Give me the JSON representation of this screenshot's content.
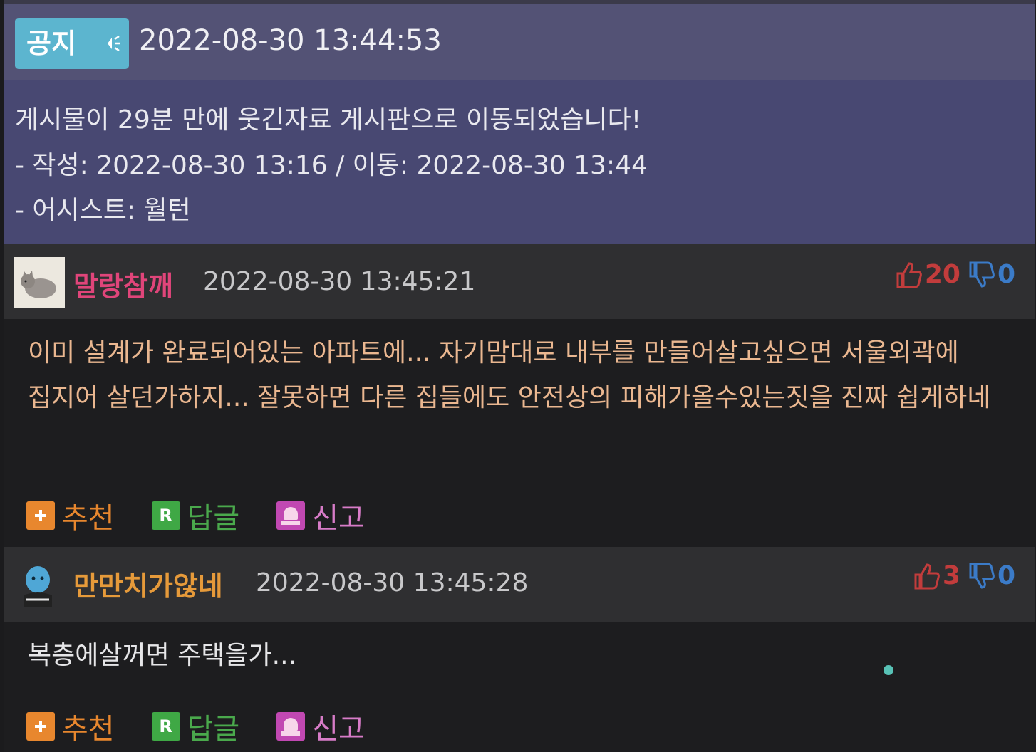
{
  "notice": {
    "badge": "공지",
    "timestamp": "2022-08-30 13:44:53",
    "lines": [
      "게시물이 29분 만에 웃긴자료 게시판으로 이동되었습니다!",
      "- 작성: 2022-08-30 13:16 / 이동: 2022-08-30 13:44",
      "- 어시스트: 월턴"
    ]
  },
  "comments": [
    {
      "nickname": "말랑참깨",
      "timestamp": "2022-08-30 13:45:21",
      "upvotes": "20",
      "downvotes": "0",
      "text": "이미 설계가 완료되어있는 아파트에... 자기맘대로 내부를 만들어살고싶으면 서울외곽에 집지어 살던가하지... 잘못하면 다른 집들에도 안전상의 피해가올수있는짓을 진짜 쉽게하네"
    },
    {
      "nickname": "만만치가않네",
      "timestamp": "2022-08-30 13:45:28",
      "upvotes": "3",
      "downvotes": "0",
      "text": "복층에살꺼면 주택을가..."
    }
  ],
  "actions": {
    "recommend": "추천",
    "reply": "답글",
    "reply_icon": "R",
    "report": "신고"
  },
  "colors": {
    "notice_header": "#535275",
    "notice_body": "#484872",
    "nickname_1": "#e0457a",
    "nickname_2": "#e69a3a",
    "upvote": "#c23c3c",
    "downvote": "#3b7bc8"
  }
}
